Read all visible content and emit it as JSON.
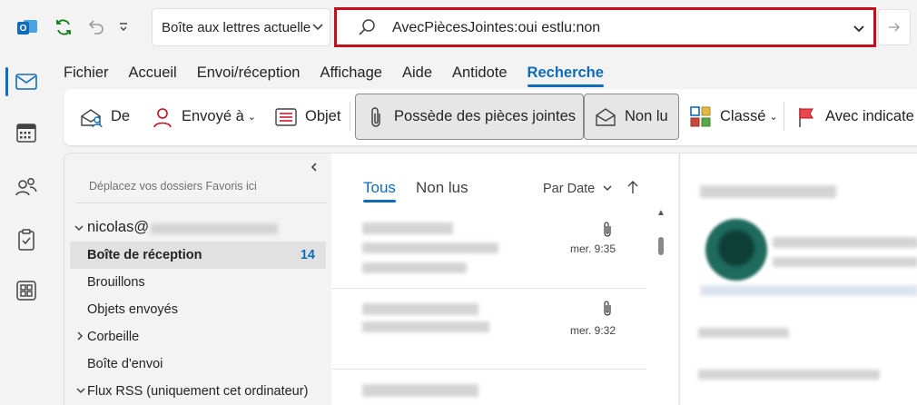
{
  "titlebar": {
    "mailbox_scope": "Boîte aux lettres actuelle",
    "search_query": "AvecPiècesJointes:oui estlu:non"
  },
  "ribbon_tabs": [
    {
      "label": "Fichier",
      "active": false
    },
    {
      "label": "Accueil",
      "active": false
    },
    {
      "label": "Envoi/réception",
      "active": false
    },
    {
      "label": "Affichage",
      "active": false
    },
    {
      "label": "Aide",
      "active": false
    },
    {
      "label": "Antidote",
      "active": false
    },
    {
      "label": "Recherche",
      "active": true
    }
  ],
  "ribbon": {
    "from": "De",
    "sent_to": "Envoyé à",
    "subject": "Objet",
    "has_attachments": "Possède des pièces jointes",
    "unread": "Non lu",
    "categorized": "Classé",
    "flagged": "Avec indicate"
  },
  "folder_pane": {
    "favorites_hint": "Déplacez vos dossiers Favoris ici",
    "account_prefix": "nicolas@",
    "folders": [
      {
        "label": "Boîte de réception",
        "count": "14",
        "selected": true
      },
      {
        "label": "Brouillons"
      },
      {
        "label": "Objets envoyés"
      },
      {
        "label": "Corbeille",
        "collapsed": true
      },
      {
        "label": "Boîte d'envoi"
      },
      {
        "label": "Flux RSS (uniquement cet ordinateur)",
        "expanded": true
      }
    ]
  },
  "message_list": {
    "tab_all": "Tous",
    "tab_unread": "Non lus",
    "sort_label": "Par Date",
    "messages": [
      {
        "time": "mer. 9:35",
        "has_attachment": true
      },
      {
        "time": "mer. 9:32",
        "has_attachment": true
      }
    ]
  },
  "colors": {
    "accent": "#0f6cbd",
    "search_highlight": "#c50f1f",
    "avatar": "#1f6b5e"
  }
}
